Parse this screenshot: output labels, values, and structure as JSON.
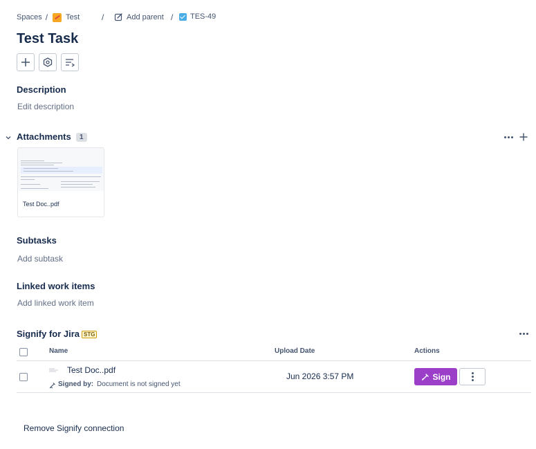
{
  "breadcrumb": {
    "spaces": "Spaces",
    "project": "Test",
    "add_parent": "Add parent",
    "issue_key": "TES-49",
    "separator": "/"
  },
  "issue": {
    "title": "Test Task"
  },
  "description": {
    "heading": "Description",
    "placeholder": "Edit description"
  },
  "attachments": {
    "heading": "Attachments",
    "count": "1",
    "files": [
      {
        "name": "Test Doc..pdf"
      }
    ]
  },
  "subtasks": {
    "heading": "Subtasks",
    "placeholder": "Add subtask"
  },
  "linked": {
    "heading": "Linked work items",
    "placeholder": "Add linked work item"
  },
  "signify": {
    "heading": "Signify for Jira",
    "env_badge": "STG",
    "columns": {
      "name": "Name",
      "upload_date": "Upload Date",
      "actions": "Actions"
    },
    "rows": [
      {
        "name": "Test Doc..pdf",
        "signed_by_label": "Signed by:",
        "signed_by_value": "Document is not signed yet",
        "upload_date": "Jun 2026 3:57 PM",
        "sign_label": "Sign"
      }
    ],
    "remove_label": "Remove Signify connection"
  },
  "colors": {
    "sign_button": "#9b3fc9",
    "link_blue": "#0c66e4",
    "text": "#172b4d"
  }
}
